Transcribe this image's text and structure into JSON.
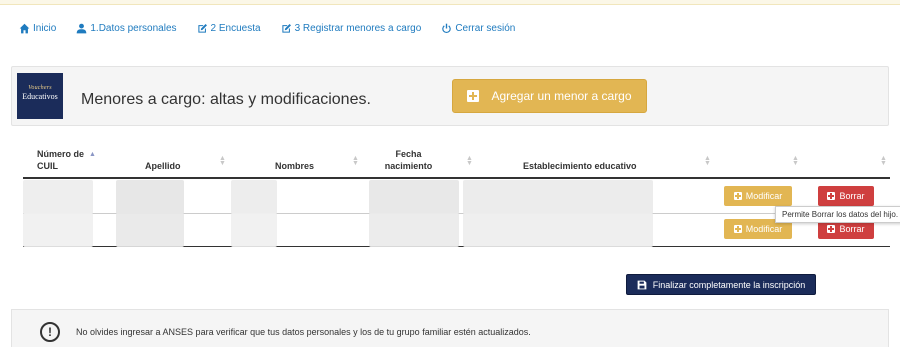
{
  "nav": {
    "inicio": "Inicio",
    "datos_personales": "1.Datos personales",
    "encuesta": "2 Encuesta",
    "registrar_menores": "3 Registrar menores a cargo",
    "cerrar_sesion": "Cerrar sesión"
  },
  "header": {
    "logo_line1": "Vouchers",
    "logo_line2": "Educativos",
    "title": "Menores a cargo: altas y modificaciones.",
    "add_button": "Agregar un menor a cargo"
  },
  "table": {
    "columns": [
      "Número de CUIL",
      "Apellido",
      "Nombres",
      "Fecha nacimiento",
      "Establecimiento educativo"
    ],
    "rows": [
      {
        "modify": "Modificar",
        "delete": "Borrar"
      },
      {
        "modify": "Modificar",
        "delete": "Borrar"
      }
    ]
  },
  "tooltip": "Permite Borrar los datos del hijo.",
  "finalize_button": "Finalizar completamente la inscripción",
  "alert": {
    "icon": "!",
    "message": "No olvides ingresar a ANSES para verificar que tus datos personales y los de tu grupo familiar estén actualizados."
  },
  "colors": {
    "link": "#1f7bbf",
    "warning": "#e2b653",
    "danger": "#cf3f3f",
    "primary_dark": "#1b2c5a"
  },
  "icons": {
    "inicio": "home-icon",
    "datos_personales": "user-icon",
    "encuesta": "edit-icon",
    "registrar_menores": "edit-icon",
    "cerrar_sesion": "power-icon",
    "finalize": "save-icon",
    "alert": "exclamation-circle-icon"
  }
}
